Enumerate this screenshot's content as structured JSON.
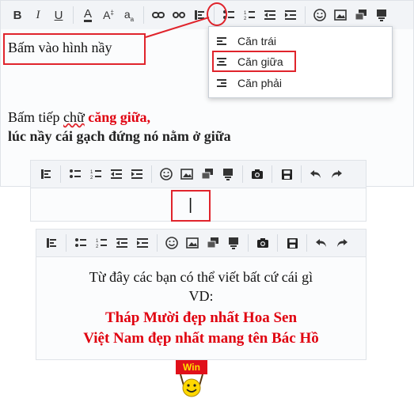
{
  "menu": {
    "items": [
      {
        "label": "Căn trái",
        "icon": "align-left-icon"
      },
      {
        "label": "Căn giữa",
        "icon": "align-center-icon"
      },
      {
        "label": "Căn phải",
        "icon": "align-right-icon"
      }
    ]
  },
  "editor1": {
    "line1": "Bấm vào hình nầy",
    "line2_a": "Bấm tiếp ",
    "line2_b": "chữ",
    "line2_c": " căng giữa,",
    "line3": "lúc nầy cái gạch đứng nó nằm ở giữa"
  },
  "editor2": {
    "cursor": "|"
  },
  "editor3": {
    "line1": "Từ đây các bạn có thể viết bất cứ cái gì",
    "line2": "VD:",
    "line3": "Tháp Mười đẹp nhất Hoa Sen",
    "line4": "Việt Nam đẹp nhất mang tên Bác Hồ",
    "sticker": "Win"
  },
  "colors": {
    "highlight": "#e0242c",
    "red_text": "#e0000f",
    "toolbar_bg": "#f2f4f7"
  }
}
